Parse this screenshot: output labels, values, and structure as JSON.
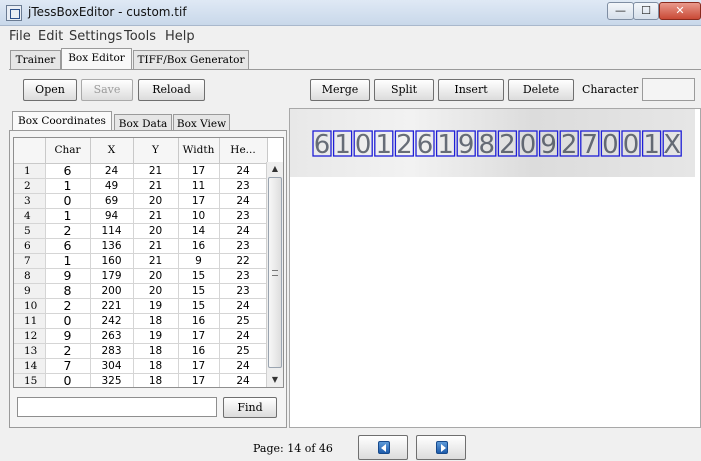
{
  "window": {
    "title": "jTessBoxEditor - custom.tif",
    "minimize": "—",
    "maximize": "☐",
    "close": "✕"
  },
  "menu": [
    "File",
    "Edit",
    "Settings",
    "Tools",
    "Help"
  ],
  "main_tabs": [
    "Trainer",
    "Box Editor",
    "TIFF/Box Generator"
  ],
  "toolbar": {
    "open": "Open",
    "save": "Save",
    "reload": "Reload",
    "merge": "Merge",
    "split": "Split",
    "insert": "Insert",
    "delete": "Delete",
    "character_label": "Character",
    "character_value": ""
  },
  "sub_tabs": [
    "Box Coordinates",
    "Box Data",
    "Box View"
  ],
  "table": {
    "columns": [
      "Char",
      "X",
      "Y",
      "Width",
      "He..."
    ],
    "rows": [
      {
        "n": "1",
        "char": "6",
        "x": "24",
        "y": "21",
        "w": "17",
        "h": "24"
      },
      {
        "n": "2",
        "char": "1",
        "x": "49",
        "y": "21",
        "w": "11",
        "h": "23"
      },
      {
        "n": "3",
        "char": "0",
        "x": "69",
        "y": "20",
        "w": "17",
        "h": "24"
      },
      {
        "n": "4",
        "char": "1",
        "x": "94",
        "y": "21",
        "w": "10",
        "h": "23"
      },
      {
        "n": "5",
        "char": "2",
        "x": "114",
        "y": "20",
        "w": "14",
        "h": "24"
      },
      {
        "n": "6",
        "char": "6",
        "x": "136",
        "y": "21",
        "w": "16",
        "h": "23"
      },
      {
        "n": "7",
        "char": "1",
        "x": "160",
        "y": "21",
        "w": "9",
        "h": "22"
      },
      {
        "n": "8",
        "char": "9",
        "x": "179",
        "y": "20",
        "w": "15",
        "h": "23"
      },
      {
        "n": "9",
        "char": "8",
        "x": "200",
        "y": "20",
        "w": "15",
        "h": "23"
      },
      {
        "n": "10",
        "char": "2",
        "x": "221",
        "y": "19",
        "w": "15",
        "h": "24"
      },
      {
        "n": "11",
        "char": "0",
        "x": "242",
        "y": "18",
        "w": "16",
        "h": "25"
      },
      {
        "n": "12",
        "char": "9",
        "x": "263",
        "y": "19",
        "w": "17",
        "h": "24"
      },
      {
        "n": "13",
        "char": "2",
        "x": "283",
        "y": "18",
        "w": "16",
        "h": "25"
      },
      {
        "n": "14",
        "char": "7",
        "x": "304",
        "y": "18",
        "w": "17",
        "h": "24"
      },
      {
        "n": "15",
        "char": "0",
        "x": "325",
        "y": "18",
        "w": "17",
        "h": "24"
      }
    ]
  },
  "scrollbar": {
    "up": "▲",
    "down": "▼"
  },
  "find": {
    "value": "",
    "button": "Find"
  },
  "image": {
    "glyphs": [
      "6",
      "1",
      "0",
      "1",
      "2",
      "6",
      "1",
      "9",
      "8",
      "2",
      "0",
      "9",
      "2",
      "7",
      "0",
      "0",
      "1",
      "X"
    ],
    "box_color": "#1f1fd6",
    "glyph_color": "#3a4250"
  },
  "pager": {
    "label": "Page:  14 of 46"
  }
}
